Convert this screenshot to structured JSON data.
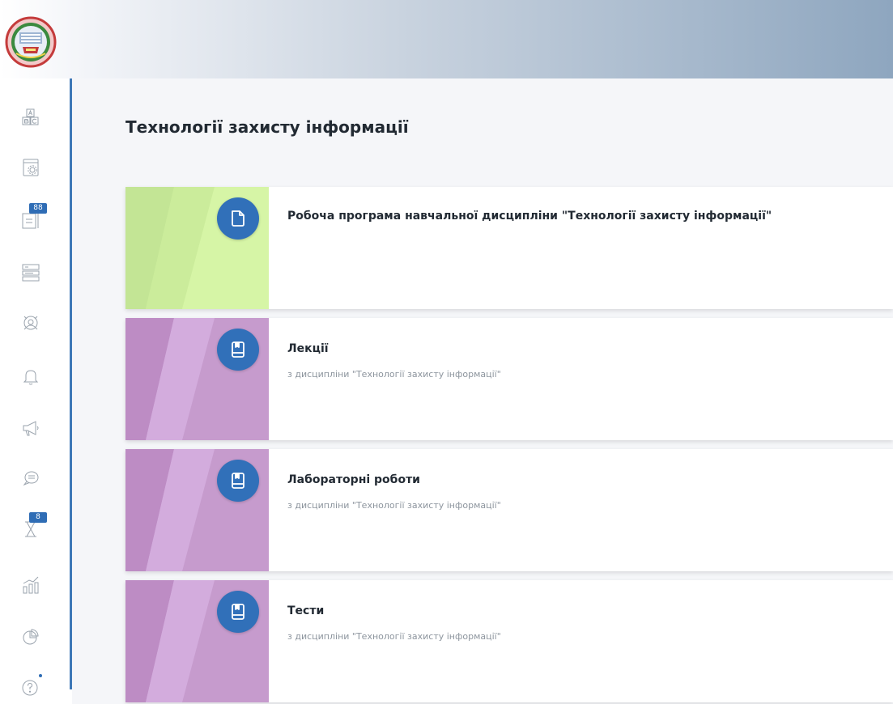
{
  "page": {
    "title": "Технології захисту інформації"
  },
  "sidebar": {
    "items": [
      {
        "icon": "alphabet-blocks-icon"
      },
      {
        "icon": "settings-window-icon"
      },
      {
        "icon": "document-list-icon",
        "badge": "88"
      },
      {
        "icon": "schedule-list-icon"
      },
      {
        "icon": "student-avatar-icon"
      },
      {
        "icon": "bell-icon"
      },
      {
        "icon": "megaphone-icon"
      },
      {
        "icon": "chat-icon"
      },
      {
        "icon": "hourglass-icon",
        "badge": "8"
      },
      {
        "icon": "bar-chart-icon"
      },
      {
        "icon": "pie-chart-icon"
      },
      {
        "icon": "help-icon"
      }
    ]
  },
  "cards": [
    {
      "title": "Робоча програма навчальної дисципліни \"Технології захисту інформації\"",
      "subtitle": "",
      "icon": "document-icon",
      "color": "#cfef9b"
    },
    {
      "title": "Лекції",
      "subtitle": "з дисципліни \"Технології захисту інформації\"",
      "icon": "book-icon",
      "color": "#d7b3e3"
    },
    {
      "title": "Лабораторні роботи",
      "subtitle": "з дисципліни \"Технології захисту інформації\"",
      "icon": "book-icon",
      "color": "#d7b3e3"
    },
    {
      "title": "Тести",
      "subtitle": "з дисципліни \"Технології захисту інформації\"",
      "icon": "book-icon",
      "color": "#d7b3e3"
    }
  ],
  "colors": {
    "accent": "#3170b9",
    "sidebar_line": "#3e78b7",
    "badge": "#2f6db5"
  }
}
